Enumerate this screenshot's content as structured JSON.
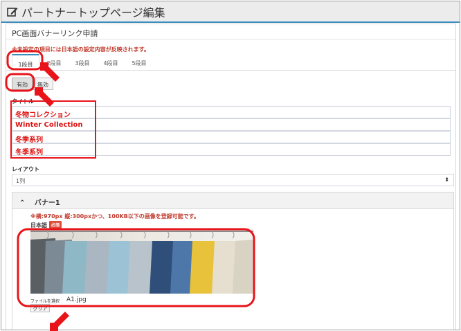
{
  "header": {
    "title": "パートナートップページ編集",
    "icon": "edit-icon"
  },
  "panel": {
    "title": "PC画面バナーリンク申請"
  },
  "notice": "※未設定の項目には日本語の設定内容が反映されます。",
  "tabs": [
    {
      "label": "1段目",
      "active": true
    },
    {
      "label": "2段目",
      "active": false
    },
    {
      "label": "3段目",
      "active": false
    },
    {
      "label": "4段目",
      "active": false
    },
    {
      "label": "5段目",
      "active": false
    }
  ],
  "toggle": {
    "enabled_label": "有効",
    "disabled_label": "無効",
    "selected": "有効"
  },
  "title_section": {
    "label": "タイトル",
    "values": [
      "冬物コレクション",
      "Winter Collection",
      "冬季系列",
      "冬季系列"
    ]
  },
  "layout_section": {
    "label": "レイアウト",
    "selected": "1列"
  },
  "banner_box": {
    "title": "バナー1",
    "warning": "※横:970px 縦:300pxかつ、100KB以下の画像を登録可能です。",
    "language_label": "日本語",
    "required_badge": "必須",
    "file_button": "ファイルを選択",
    "file_name": "A1.jpg",
    "clear_button": "クリア"
  },
  "colors": {
    "accent": "#3c8dbc",
    "highlight": "#e8141a",
    "title_text": "#dd1111"
  }
}
